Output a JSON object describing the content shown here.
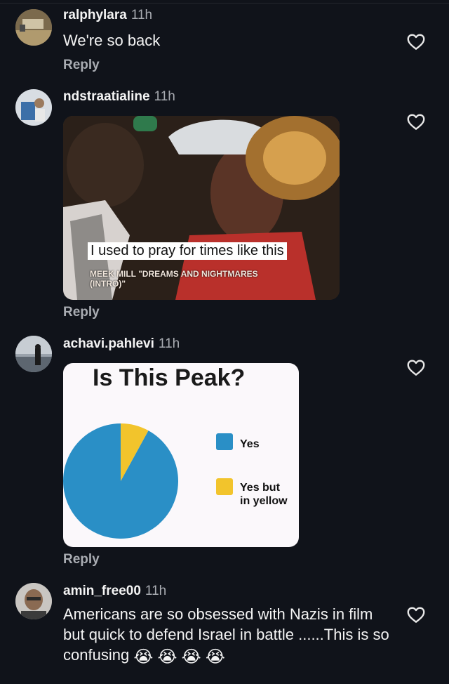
{
  "comments": [
    {
      "username": "ralphylara",
      "time": "11h",
      "text": "We're so back",
      "reply_label": "Reply"
    },
    {
      "username": "ndstraatialine",
      "time": "11h",
      "reply_label": "Reply",
      "meme": {
        "caption": "I used to pray for times like this",
        "credit": "MEEK MILL \"DREAMS AND NIGHTMARES\n(INTRO)\""
      }
    },
    {
      "username": "achavi.pahlevi",
      "time": "11h",
      "reply_label": "Reply"
    },
    {
      "username": "amin_free00",
      "time": "11h",
      "text": "Americans are so obsessed with Nazis in film but quick to defend Israel in battle ......This is so confusing",
      "emoji": "😭"
    }
  ],
  "chart_data": {
    "type": "pie",
    "title": "Is This Peak?",
    "categories": [
      "Yes",
      "Yes but in yellow"
    ],
    "values": [
      92,
      8
    ],
    "colors": [
      "#2a8fc6",
      "#f2c42c"
    ],
    "legend": "right"
  }
}
